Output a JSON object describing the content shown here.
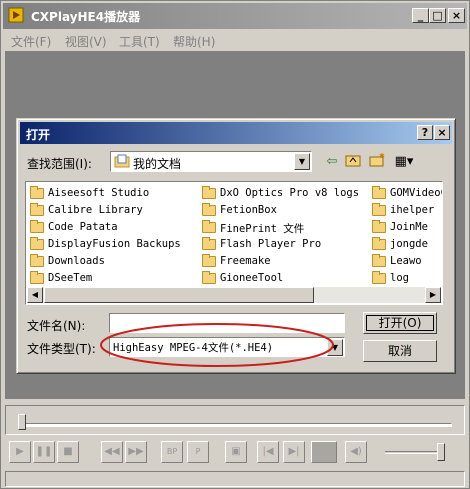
{
  "app": {
    "title": "CXPlayHE4播放器",
    "menu": [
      "文件(F)",
      "视图(V)",
      "工具(T)",
      "帮助(H)"
    ],
    "window_buttons": {
      "minimize": "_",
      "maximize": "□",
      "close": "×"
    }
  },
  "controls": {
    "bp_label": "BP",
    "p_label": "P",
    "icons": [
      "play-icon",
      "pause-icon",
      "stop-icon",
      "rewind-icon",
      "fast-forward-icon",
      "bp-icon",
      "p-icon",
      "dots-icon",
      "skip-back-icon",
      "skip-forward-icon",
      "fullscreen-icon",
      "volume-icon"
    ]
  },
  "dialog": {
    "title": "打开",
    "help_button": "?",
    "close_button": "×",
    "lookin_label": "查找范围(I):",
    "lookin_value": "我的文档",
    "filename_label": "文件名(N):",
    "filename_value": "",
    "filetype_label": "文件类型(T):",
    "filetype_value": "HighEasy MPEG-4文件(*.HE4)",
    "open_button": "打开(O)",
    "cancel_button": "取消",
    "files": [
      [
        "Aiseesoft Studio",
        "Calibre Library",
        "Code Patata",
        "DisplayFusion Backups",
        "Downloads",
        "DSeeTem"
      ],
      [
        "DxO Optics Pro v8 logs",
        "FetionBox",
        "FinePrint 文件",
        "Flash Player Pro",
        "Freemake",
        "GioneeTool"
      ],
      [
        "GOMVideoC",
        "ihelper",
        "JoinMe",
        "jongde",
        "Leawo",
        "log"
      ]
    ]
  },
  "colors": {
    "window_bg": "#d4d0c8",
    "inactive_titlebar": "#808080",
    "active_titlebar": "#0a246a",
    "highlight_ellipse": "#c8201c"
  }
}
